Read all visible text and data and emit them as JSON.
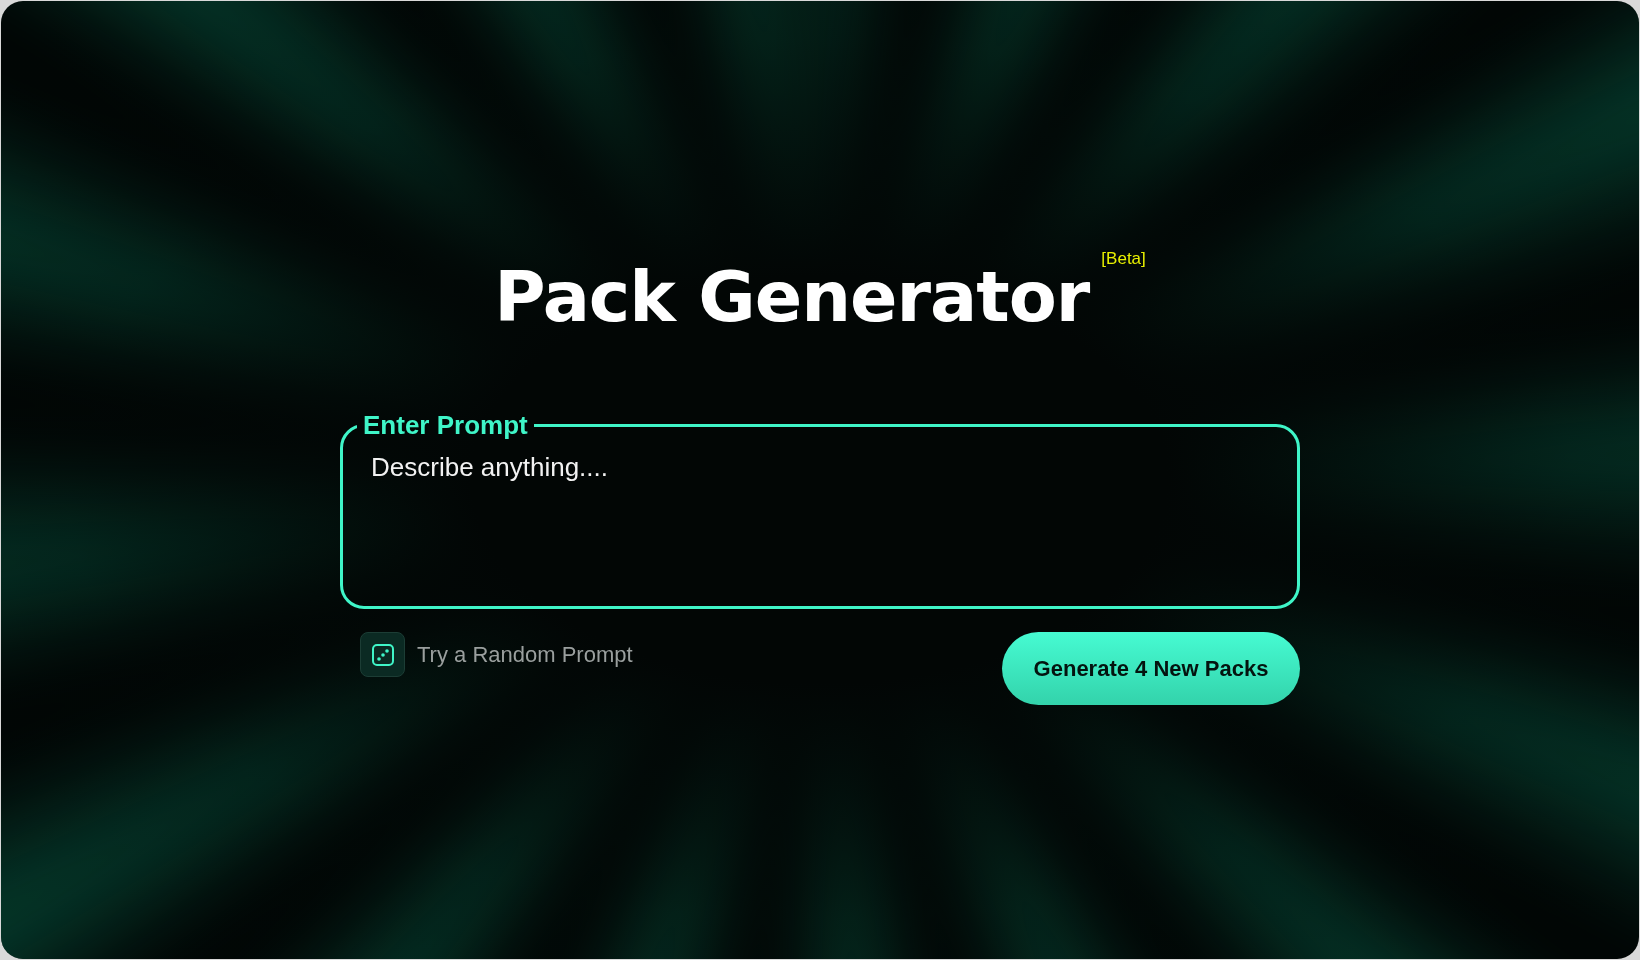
{
  "title": "Pack Generator",
  "badge": "[Beta]",
  "prompt": {
    "label": "Enter Prompt",
    "placeholder": "Describe anything...."
  },
  "random_prompt": {
    "label": "Try a Random Prompt"
  },
  "generate_button": {
    "label": "Generate 4 New Packs"
  }
}
